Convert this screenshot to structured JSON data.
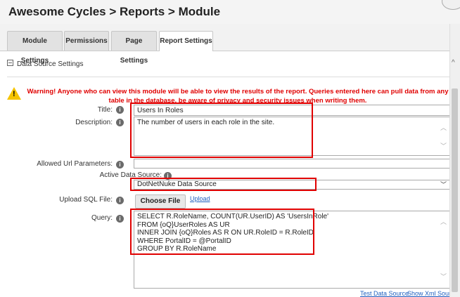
{
  "header": {
    "title": "Awesome Cycles > Reports > Module"
  },
  "tabs": [
    {
      "label": "Module Settings"
    },
    {
      "label": "Permissions"
    },
    {
      "label": "Page Settings"
    },
    {
      "label": "Report Settings",
      "active": true
    }
  ],
  "section": {
    "title": "Data Source Settings"
  },
  "warning": {
    "text": "Warning! Anyone who can view this module will be able to view the results of the report. Queries entered here can pull data from any table in the database, be aware of privacy and security issues when writing them."
  },
  "form": {
    "title_label": "Title:",
    "title_value": "Users In Roles",
    "description_label": "Description:",
    "description_value": "The number of users in each role in the site.",
    "allowed_url_label": "Allowed Url Parameters:",
    "allowed_url_value": "",
    "data_source_label": "Active Data Source:",
    "data_source_value": "DotNetNuke Data Source",
    "upload_label": "Upload SQL File:",
    "choose_file_label": "Choose File",
    "upload_link": "Upload",
    "query_label": "Query:",
    "query_value": "SELECT R.RoleName, COUNT(UR.UserID) AS 'UsersInRole'\nFROM {oQ}UserRoles AS UR\nINNER JOIN {oQ}Roles AS R ON UR.RoleID = R.RoleID\nWHERE PortalID = @PortalID\nGROUP BY R.RoleName"
  },
  "footer": {
    "test_link": "Test Data Source",
    "xml_link": "Show Xml Source"
  },
  "icons": {
    "info": "i",
    "warning": "!"
  },
  "colors": {
    "highlight": "#e00000",
    "warning_text": "#e00000",
    "link": "#1f5fbf"
  }
}
